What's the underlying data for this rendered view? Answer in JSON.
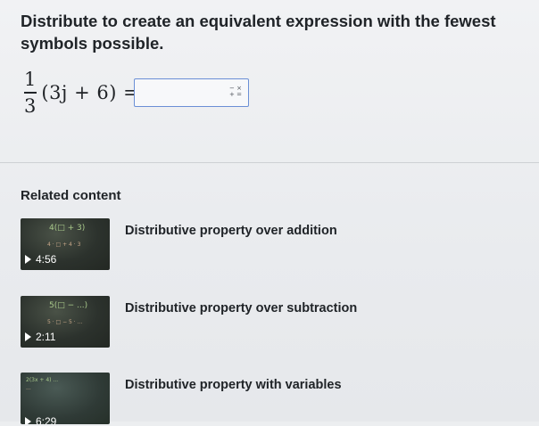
{
  "question": {
    "prompt": "Distribute to create an equivalent expression with the fewest symbols possible.",
    "fraction_numerator": "1",
    "fraction_denominator": "3",
    "expression": "(3j + 6) =",
    "answer_value": "",
    "keypad_icon": "math-keypad-icon",
    "keypad_symbols": "− ×\n+ ="
  },
  "related": {
    "heading": "Related content",
    "videos": [
      {
        "title": "Distributive property over addition",
        "duration": "4:56",
        "thumb_text": "4(□ + 3)",
        "thumb_text2": "4 · □ + 4 · 3"
      },
      {
        "title": "Distributive property over subtraction",
        "duration": "2:11",
        "thumb_text": "5(□ − ...)",
        "thumb_text2": "5 · □ − 5 · ..."
      },
      {
        "title": "Distributive property with variables",
        "duration": "6:29",
        "thumb_text": "2(3x + 4) ...",
        "thumb_text2": "..."
      }
    ]
  },
  "colors": {
    "input_border": "#6b8fd6",
    "thumb_bg": "#2c322d"
  }
}
